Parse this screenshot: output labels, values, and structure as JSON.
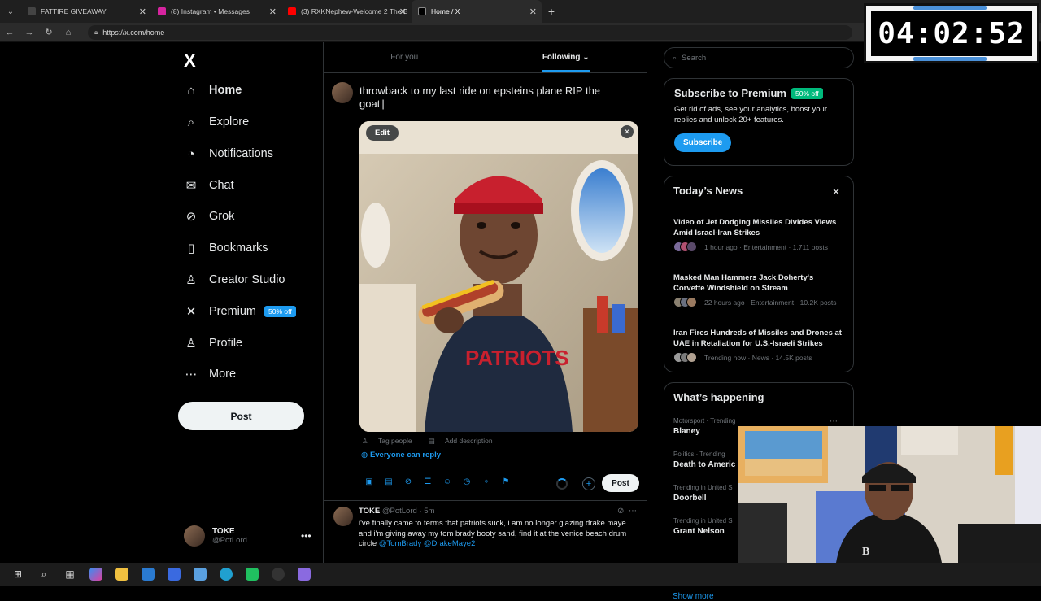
{
  "browser": {
    "tabs": [
      {
        "title": "FATTIRE GIVEAWAY",
        "fav_color": "#333"
      },
      {
        "title": "(8) Instagram • Messages",
        "fav_color": "#d6249f"
      },
      {
        "title": "(3) RXKNephew-Welcome 2 The B",
        "fav_color": "#ff0000"
      },
      {
        "title": "Home / X",
        "fav_color": "#000"
      }
    ],
    "url": "https://x.com/home"
  },
  "sidebar": {
    "logo": "X",
    "items": [
      {
        "label": "Home",
        "icon": "home-icon",
        "glyph": "⌂"
      },
      {
        "label": "Explore",
        "icon": "search-icon",
        "glyph": "⌕"
      },
      {
        "label": "Notifications",
        "icon": "bell-icon",
        "glyph": "◔"
      },
      {
        "label": "Chat",
        "icon": "mail-icon",
        "glyph": "✉"
      },
      {
        "label": "Grok",
        "icon": "grok-icon",
        "glyph": "⊘"
      },
      {
        "label": "Bookmarks",
        "icon": "bookmark-icon",
        "glyph": "▯"
      },
      {
        "label": "Creator Studio",
        "icon": "creator-studio-icon",
        "glyph": "♙"
      },
      {
        "label": "Premium",
        "icon": "x-premium-icon",
        "glyph": "✕"
      },
      {
        "label": "Profile",
        "icon": "person-icon",
        "glyph": "♙"
      },
      {
        "label": "More",
        "icon": "more-circle-icon",
        "glyph": "⋯"
      }
    ],
    "premium_badge": "50% off",
    "post_button": "Post",
    "account": {
      "name": "TOKE",
      "handle": "@PotLord"
    }
  },
  "main": {
    "tabs": [
      {
        "label": "For you"
      },
      {
        "label": "Following"
      }
    ],
    "compose": {
      "text": "throwback to my last ride on epsteins plane RIP the goat",
      "edit_label": "Edit",
      "tag_people": "Tag people",
      "add_description": "Add description",
      "reply_setting": "Everyone can reply",
      "post_label": "Post"
    },
    "tweet": {
      "name": "TOKE",
      "handle": "@PotLord · 5m",
      "body": "i've finally came to terms that patriots suck, i am no longer glazing drake maye and i'm giving away my tom brady booty sand, find it at the venice beach drum circle",
      "mentions": "@TomBrady @DrakeMaye2"
    }
  },
  "right": {
    "search_placeholder": "Search",
    "premium": {
      "title": "Subscribe to Premium",
      "badge": "50% off",
      "desc": "Get rid of ads, see your analytics, boost your replies and unlock 20+ features.",
      "button": "Subscribe"
    },
    "news": {
      "title": "Today’s News",
      "items": [
        {
          "headline": "Video of Jet Dodging Missiles Divides Views Amid Israel-Iran Strikes",
          "meta": "1 hour ago · Entertainment · 1,711 posts"
        },
        {
          "headline": "Masked Man Hammers Jack Doherty's Corvette Windshield on Stream",
          "meta": "22 hours ago · Entertainment · 10.2K posts"
        },
        {
          "headline": "Iran Fires Hundreds of Missiles and Drones at UAE in Retaliation for U.S.-Israeli Strikes",
          "meta": "Trending now · News · 14.5K posts"
        }
      ]
    },
    "happening": {
      "title": "What’s happening",
      "trends": [
        {
          "category": "Motorsport · Trending",
          "name": "Blaney"
        },
        {
          "category": "Politics · Trending",
          "name": "Death to Americ"
        },
        {
          "category": "Trending in United S",
          "name": "Doorbell"
        },
        {
          "category": "Trending in United S",
          "name": "Grant Nelson"
        }
      ],
      "show_more": "Show more"
    }
  },
  "overlay": {
    "timer": "04:02:52"
  }
}
